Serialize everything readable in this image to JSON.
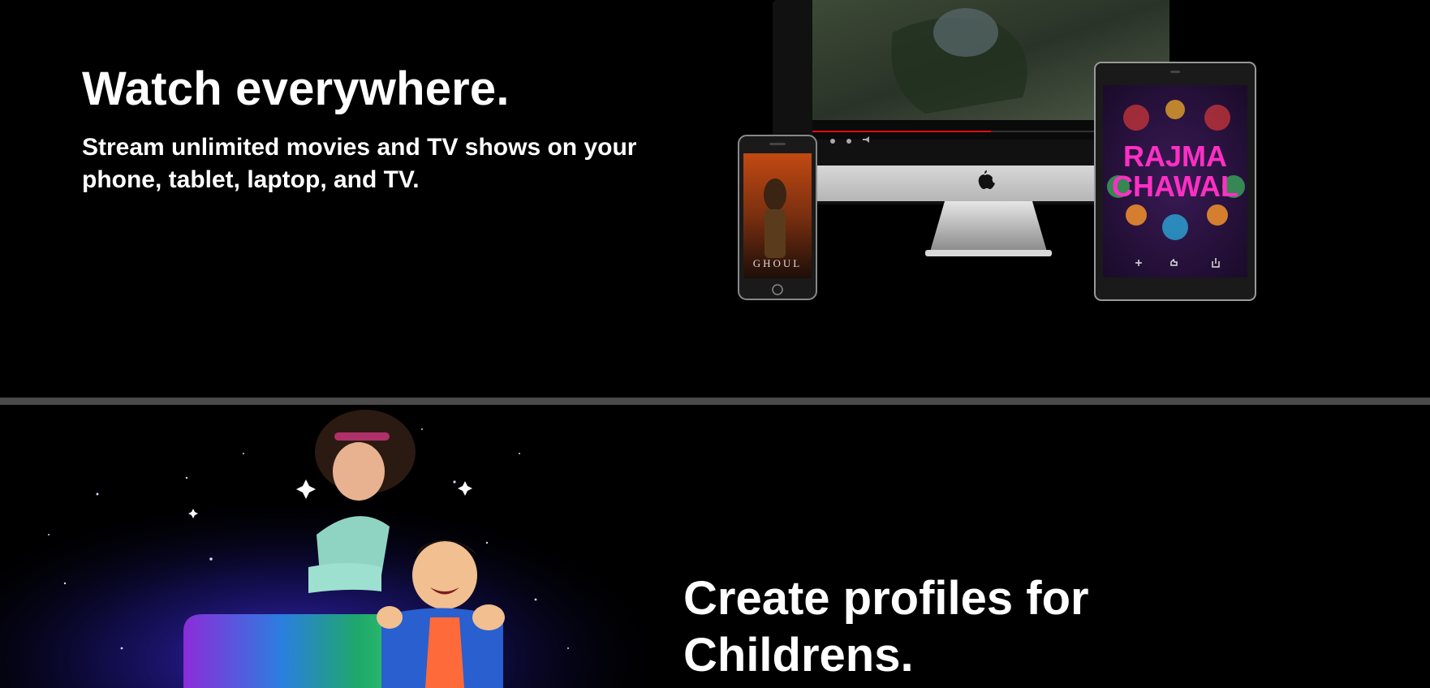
{
  "watch_section": {
    "heading": "Watch everywhere.",
    "description": "Stream unlimited movies and TV shows on your phone, tablet, laptop, and TV.",
    "phone_poster_title": "GHOUL",
    "tablet_poster_title_line1": "RAJMA",
    "tablet_poster_title_line2": "CHAWAL"
  },
  "profiles_section": {
    "heading": "Create profiles for Childrens."
  },
  "colors": {
    "background": "#000000",
    "divider": "#4a4a4a",
    "text": "#ffffff",
    "progress_red": "#e50914",
    "poster_magenta": "#ff2fc4"
  },
  "icons": [
    "apple-logo-icon",
    "plus-icon",
    "thumbs-up-icon",
    "share-icon",
    "rewind-icon",
    "forward-icon",
    "volume-icon"
  ]
}
